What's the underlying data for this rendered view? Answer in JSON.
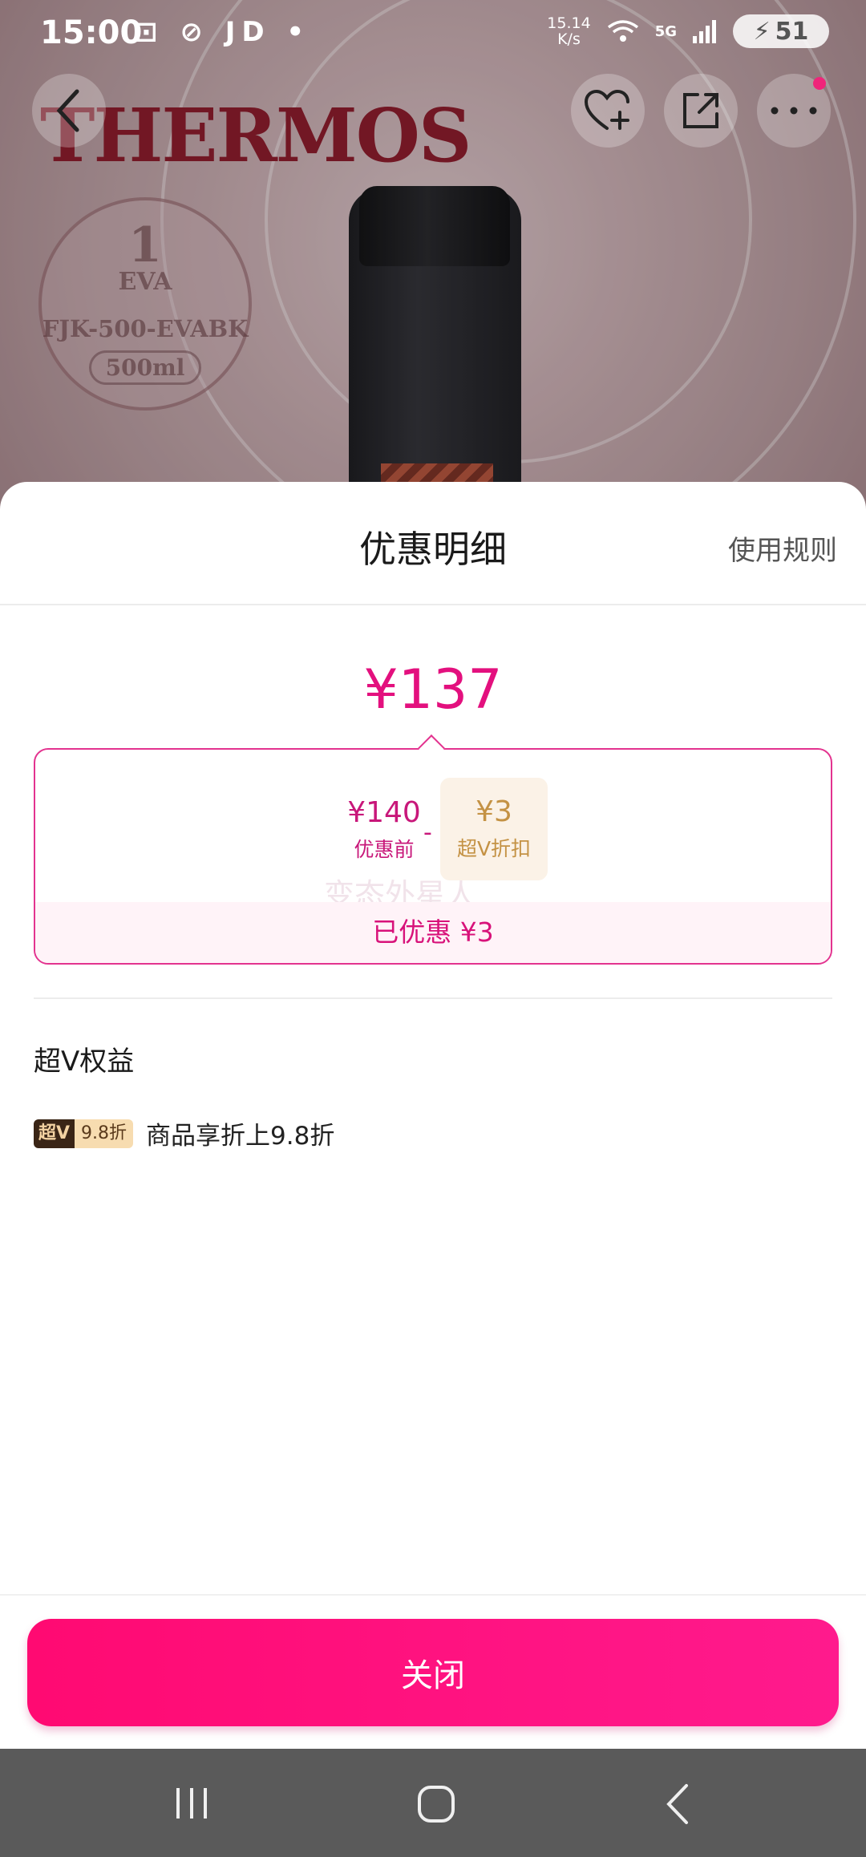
{
  "status_bar": {
    "time": "15:00",
    "app_label": "JD",
    "net_speed_value": "15.14",
    "net_speed_unit": "K/s",
    "network": "5G",
    "battery": "51"
  },
  "header_image": {
    "brand": "THERMOS",
    "seal_badge_number": "1",
    "seal_badge_text": "EVA",
    "model": "FJK-500-EVABK",
    "volume": "500ml"
  },
  "sheet": {
    "title": "优惠明细",
    "rules_link": "使用规则",
    "final_price": "¥137",
    "breakdown": {
      "before_value": "¥140",
      "before_label": "优惠前",
      "operator": "-",
      "discount_value": "¥3",
      "discount_label": "超V折扣",
      "watermark": "变态外星人",
      "saved_text": "已优惠 ¥3"
    },
    "benefits_title": "超V权益",
    "benefit": {
      "tag_left": "超V",
      "tag_right": "9.8折",
      "text": "商品享折上9.8折"
    },
    "close_button": "关闭"
  },
  "colors": {
    "accent": "#e3107e",
    "button": "#ff0a72",
    "gold": "#c49244"
  },
  "icons": [
    "back-icon",
    "favorite-add-icon",
    "share-icon",
    "more-icon",
    "recent-apps-icon",
    "home-icon",
    "nav-back-icon"
  ]
}
